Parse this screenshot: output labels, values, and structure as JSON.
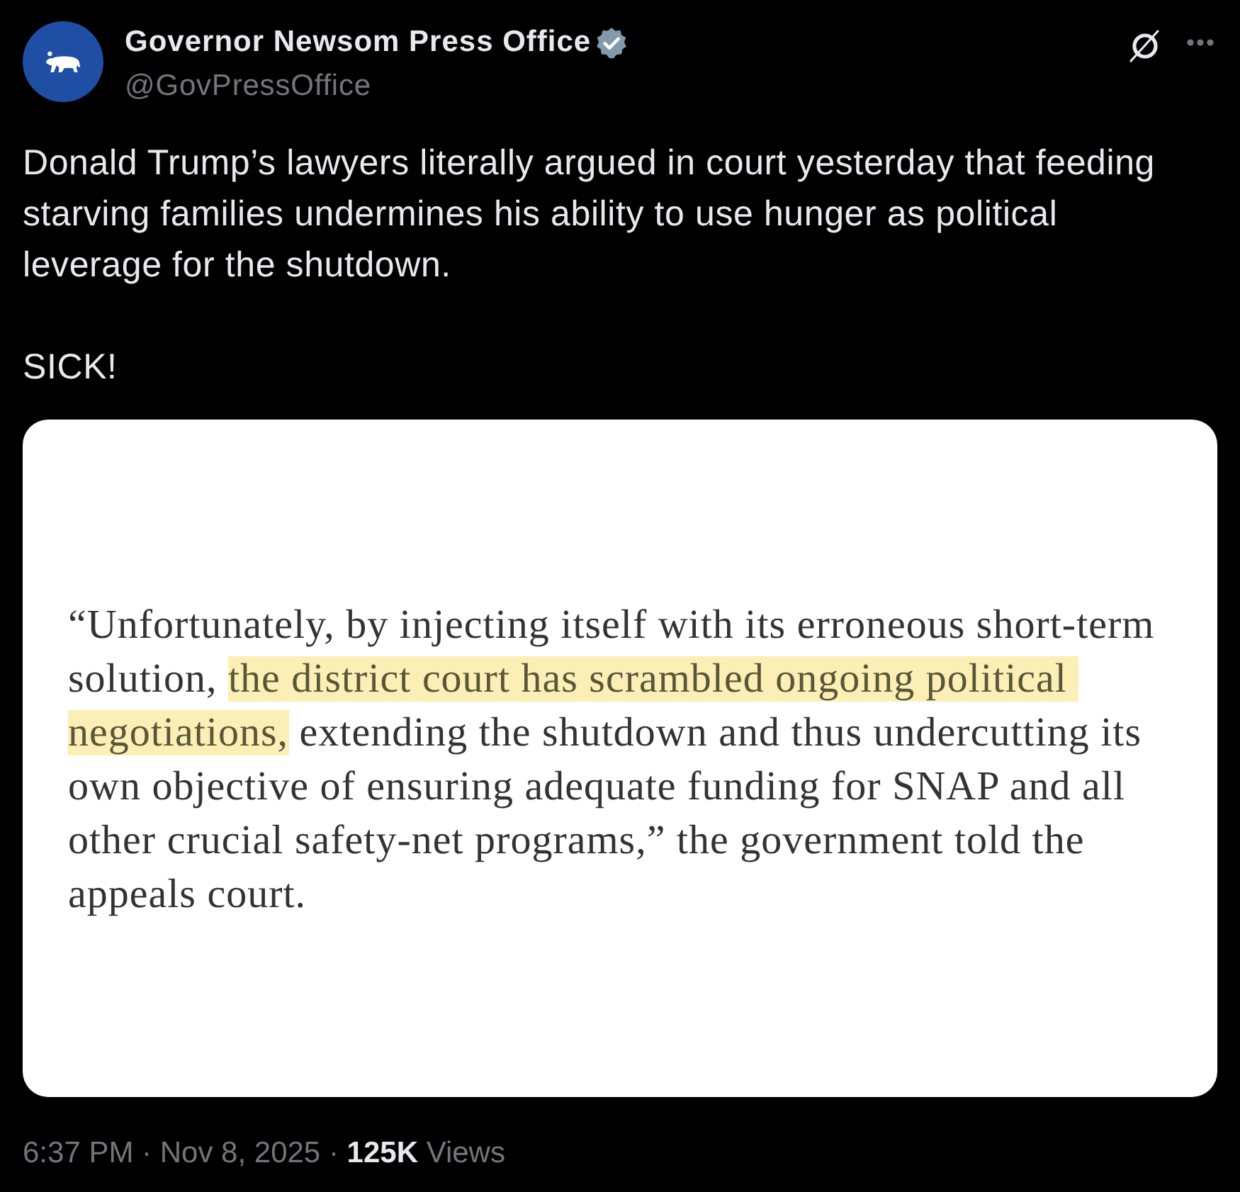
{
  "post": {
    "author": {
      "name": "Governor Newsom Press Office",
      "verified": true,
      "handle": "@GovPressOffice"
    },
    "paragraphs": [
      "Donald Trump’s lawyers literally argued in court yesterday that feeding starving families undermines his ability to use hunger as political leverage for the shutdown.",
      "SICK!"
    ],
    "image": {
      "quote_lines": [
        [
          {
            "text": "“Unfortunately, by injecting itself with its erroneous short-term",
            "highlighted": false
          }
        ],
        [
          {
            "text": "solution, ",
            "highlighted": false
          },
          {
            "text": "the district court has scrambled ongoing political ",
            "highlighted": true
          }
        ],
        [
          {
            "text": "negotiations,",
            "highlighted": true
          },
          {
            "text": " extending the shutdown and thus undercutting its",
            "highlighted": false
          }
        ],
        [
          {
            "text": "own objective of ensuring adequate funding for SNAP and all",
            "highlighted": false
          }
        ],
        [
          {
            "text": "other crucial safety-net programs,” the government told the",
            "highlighted": false
          }
        ],
        [
          {
            "text": "appeals court.",
            "highlighted": false
          }
        ]
      ]
    },
    "footer": "6:37 PM · Nov 8, 2025 · **125K** Views"
  }
}
